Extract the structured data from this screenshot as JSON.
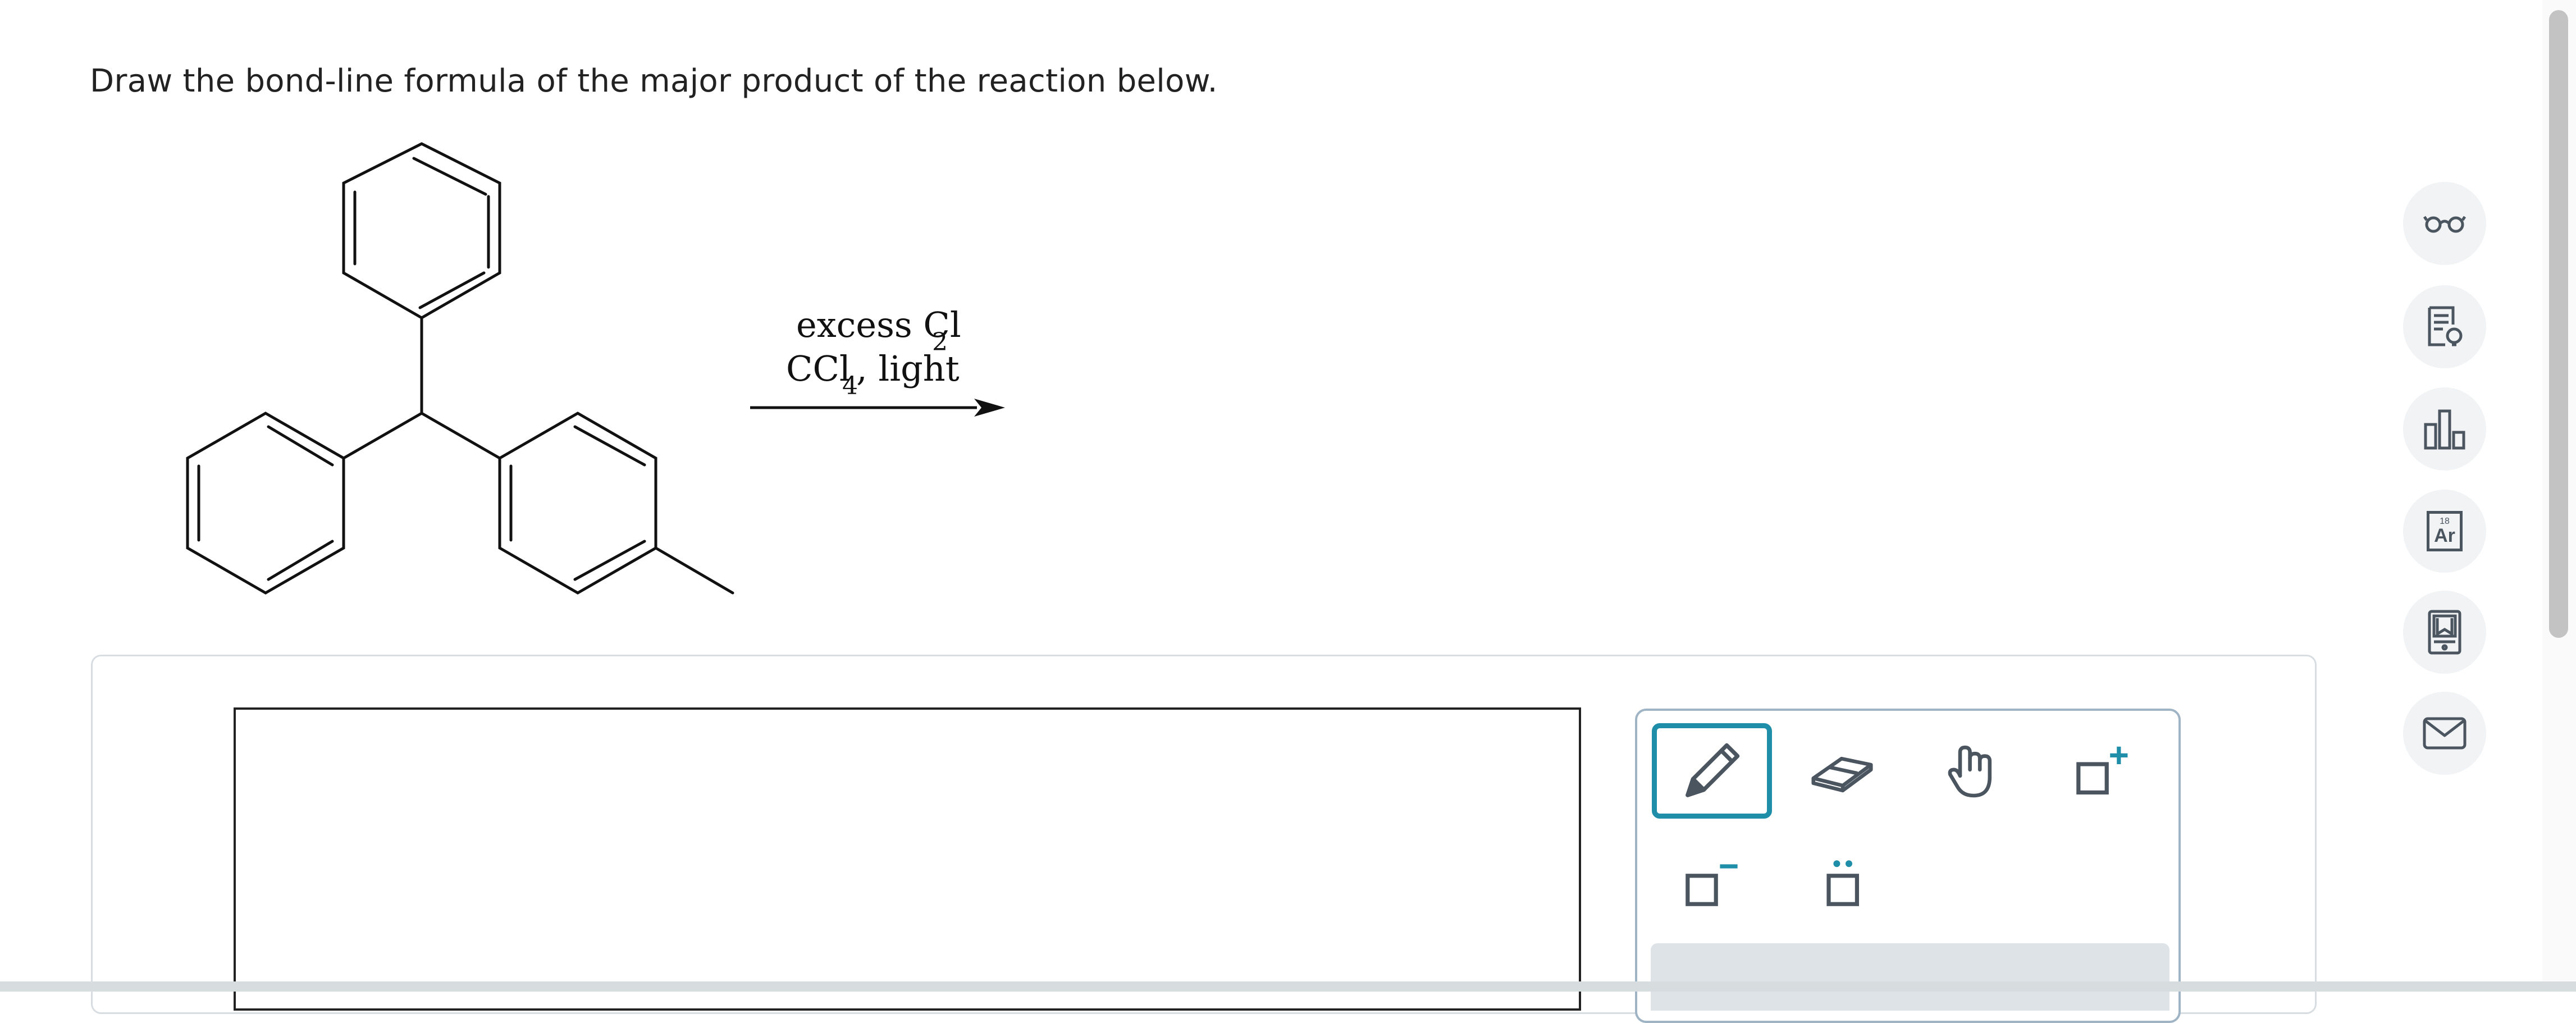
{
  "question": {
    "prompt": "Draw the bond-line formula of the major product of the reaction below."
  },
  "reaction": {
    "reagent_line1_main": "excess Cl",
    "reagent_line1_sub": "2",
    "reagent_line2_a": "CCl",
    "reagent_line2_sub": "4",
    "reagent_line2_b": ", light"
  },
  "toolbox": {
    "active_tool": "pencil",
    "tools": [
      "pencil",
      "eraser",
      "hand",
      "add-positive-charge",
      "add-negative-charge",
      "lone-pair"
    ]
  },
  "side_toolbar": {
    "buttons": [
      "glasses-icon",
      "hint-document-icon",
      "bar-chart-icon",
      "periodic-table-icon",
      "textbook-icon",
      "message-icon"
    ],
    "periodic_element_number": "18",
    "periodic_element_symbol": "Ar"
  },
  "colors": {
    "accent": "#1f8ea8",
    "icon": "#4a5560",
    "panel_border": "#d8dde1",
    "toolbox_border": "#9fb4c4"
  }
}
